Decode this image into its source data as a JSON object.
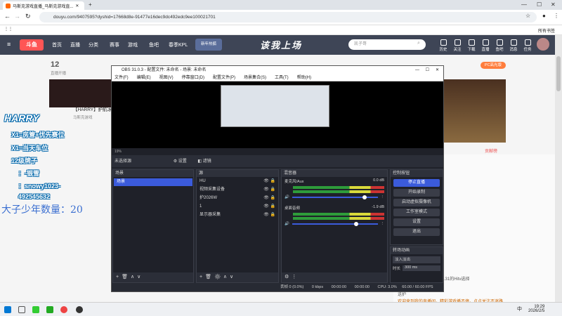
{
  "browser": {
    "tab_title": "马斯克游戏直播_马斯克游戏直...",
    "url": "douyu.com/9407595?dyshid=17668d8e-91477e16dec9dc492edc9ee100021701",
    "bookmarks": "所有书签"
  },
  "douyu": {
    "logo": "斗鱼",
    "nav": [
      "首页",
      "直播",
      "分类",
      "赛事",
      "游戏",
      "鱼吧",
      "春季KPL"
    ],
    "promo": "新年热狐",
    "slogan": "该我上场",
    "search": "凯子哥",
    "header_icons": [
      "历史",
      "关注",
      "下载",
      "直播",
      "鱼吧",
      "消息",
      "任务"
    ],
    "stat_num": "12",
    "stat_label": "直播开播",
    "streamer": "【HARRY】护航冰...",
    "streamer_sub": "马斯克游戏",
    "pc_badge": "PC高光版",
    "side_label": "贡献榜"
  },
  "overlay": {
    "name": "HARRY",
    "lines": [
      "X1=房管+优先赛位",
      "X1=当天车位",
      "12级牌子",
      "：-银雪",
      "：snowy1023-",
      "492545632"
    ],
    "footer": "大子少年数量：20"
  },
  "obs": {
    "title": "OBS 31.0.3 - 配置文件: 未命名 - 场景: 未命名",
    "menu": [
      "文件(F)",
      "编辑(E)",
      "视图(V)",
      "停靠窗口(D)",
      "配置文件(P)",
      "场景集合(S)",
      "工具(T)",
      "帮助(H)"
    ],
    "zoom": "19%",
    "scene_bar_label": "未选择源",
    "settings_label": "设置",
    "filter_label": "滤镜",
    "scenes_title": "场景",
    "scenes": [
      "场景"
    ],
    "sources_title": "源",
    "sources": [
      "HU",
      "视频采集设备",
      "护2026W",
      "1",
      "显示器采集"
    ],
    "mixer_title": "混音器",
    "mixer": [
      {
        "name": "麦克风/Aux",
        "db": "0.0 dB",
        "level": 0.85
      },
      {
        "name": "桌面音频",
        "db": "-1.9 dB",
        "level": 0.75
      }
    ],
    "controls_title": "控制按钮",
    "controls": [
      "停止直播",
      "开始录制",
      "启动虚拟摄像机",
      "工作室模式",
      "设置",
      "退出"
    ],
    "transitions_title": "转场动画",
    "transition": "淡入淡出",
    "duration_label": "时长",
    "duration": "300 ms",
    "status": {
      "drop": "丢帧 0 (0.0%)",
      "kbps": "0 kbps",
      "rec": "00:00:00",
      "live": "00:00:00",
      "cpu": "CPU: 3.0%",
      "fps": "60.00 / 60.00 FPS"
    }
  },
  "chat": {
    "lines": [
      "贡献",
      "帮助的护航",
      "中10 S+1.3Bat, Rt1.31的Hitv选择",
      "送护",
      "欢迎来到我的直播间，精彩游戏播不停，点点关注不迷路"
    ]
  },
  "taskbar": {
    "time": "19:29",
    "date": "2026/2/5",
    "lang": "中"
  }
}
